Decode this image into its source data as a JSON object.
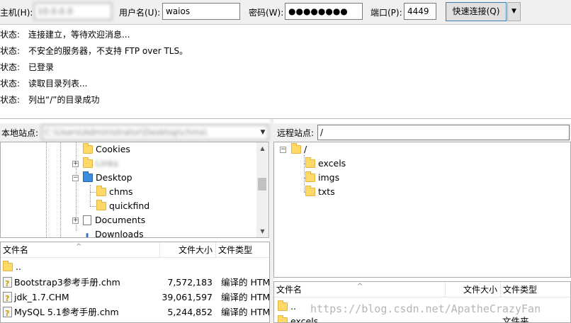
{
  "quickconnect": {
    "host_label": "主机(H):",
    "host_value": "10.0.0.0",
    "user_label": "用户名(U):",
    "user_value": "waios",
    "pass_label": "密码(W):",
    "pass_value": "●●●●●●●●",
    "port_label": "端口(P):",
    "port_value": "4449",
    "connect_label": "快速连接(Q)",
    "dropdown_icon": "▼"
  },
  "log": [
    {
      "status": "状态:",
      "message": "连接建立，等待欢迎消息..."
    },
    {
      "status": "状态:",
      "message": "不安全的服务器，不支持 FTP over TLS。"
    },
    {
      "status": "状态:",
      "message": "已登录"
    },
    {
      "status": "状态:",
      "message": "读取目录列表..."
    },
    {
      "status": "状态:",
      "message": "列出“/”的目录成功"
    }
  ],
  "local_site": {
    "label": "本地站点:",
    "path": "C:\\Users\\Administrator\\Desktop\\chms\\"
  },
  "remote_site": {
    "label": "远程站点:",
    "path": "/"
  },
  "local_tree": {
    "cookies": "Cookies",
    "blurred_folder": "Links",
    "desktop": "Desktop",
    "chms": "chms",
    "quickfind": "quickfind",
    "documents": "Documents",
    "downloads": "Downloads"
  },
  "remote_tree": {
    "root": "/",
    "children": [
      "excels",
      "imgs",
      "txts"
    ]
  },
  "local_files": {
    "headers": {
      "name": "文件名",
      "size": "文件大小",
      "type": "文件类型"
    },
    "rows": [
      {
        "name": "..",
        "size": "",
        "type": ""
      },
      {
        "name": "Bootstrap3参考手册.chm",
        "size": "7,572,183",
        "type": "编译的 HTM"
      },
      {
        "name": "jdk_1.7.CHM",
        "size": "39,061,597",
        "type": "编译的 HTM"
      },
      {
        "name": "MySQL 5.1参考手册.chm",
        "size": "5,244,852",
        "type": "编译的 HTM"
      }
    ]
  },
  "remote_files": {
    "headers": {
      "name": "文件名",
      "size": "文件大小",
      "type": "文件类型"
    },
    "rows": [
      {
        "name": "..",
        "size": "",
        "type": ""
      },
      {
        "name": "excels",
        "size": "",
        "type": "文件夹"
      }
    ]
  },
  "watermark": "https://blog.csdn.net/ApatheCrazyFan",
  "colors": {
    "toolbar_bg": "#f0f0f0",
    "folder_yellow": "#ffd966",
    "folder_blue": "#3d8ddc",
    "button_border": "#3c7fb1"
  }
}
